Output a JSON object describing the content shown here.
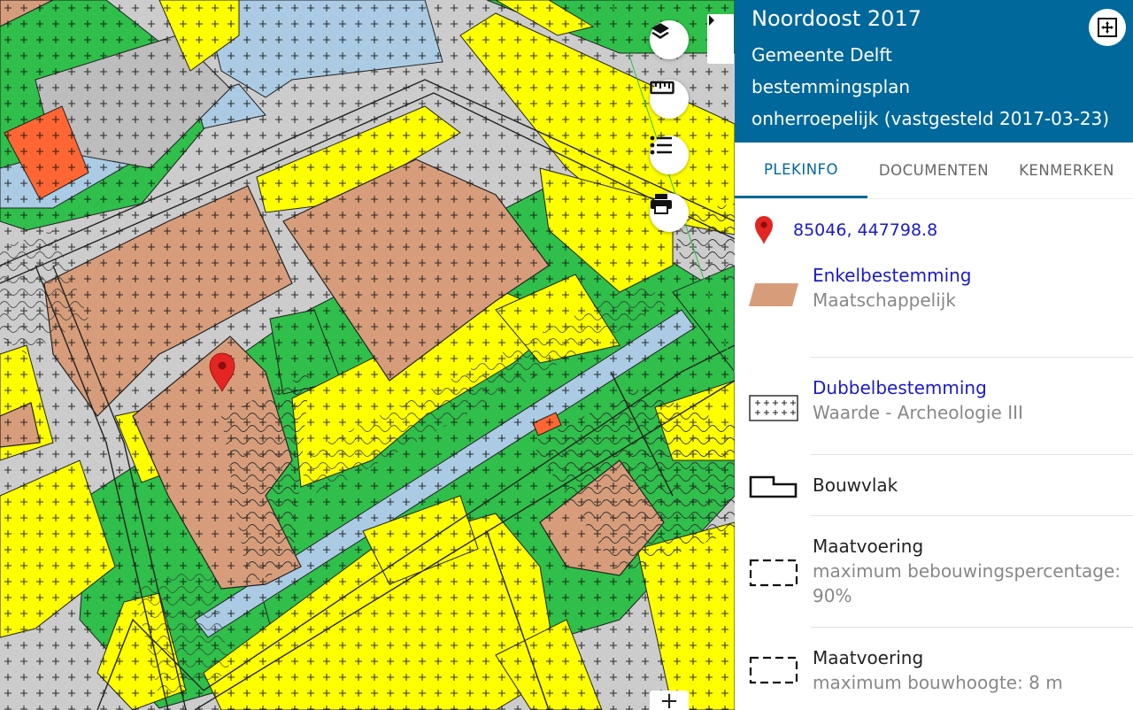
{
  "panel": {
    "title": "Noordoost 2017",
    "lines": [
      "Gemeente Delft",
      "bestemmingsplan",
      "onherroepelijk (vastgesteld 2017-03-23)"
    ],
    "tabs": [
      "PLEKINFO",
      "DOCUMENTEN",
      "KENMERKEN"
    ],
    "active_tab": "PLEKINFO",
    "coordinates": "85046, 447798.8",
    "items": [
      {
        "title": "Enkelbestemming",
        "sub": "Maatschappelijk",
        "symbol": "parallelogram-brown"
      },
      {
        "title": "Dubbelbestemming",
        "sub": "Waarde - Archeologie III",
        "symbol": "crosses-pattern"
      },
      {
        "title": "Bouwvlak",
        "sub": "",
        "symbol": "building-outline"
      },
      {
        "title": "Maatvoering",
        "sub": "maximum bebouwingspercentage: 90%",
        "symbol": "dashed-box"
      },
      {
        "title": "Maatvoering",
        "sub": "maximum bouwhoogte: 8 m",
        "symbol": "dashed-box"
      }
    ]
  },
  "map_tools": [
    "layers-icon",
    "ruler-icon",
    "legend-list-icon",
    "print-icon"
  ],
  "zoom_in_label": "+",
  "colors": {
    "header": "#01689b",
    "maatschappelijk": "#d79d7b",
    "wonen": "#ffff00",
    "groen": "#2fbf4a",
    "water": "#aacbe3",
    "verkeer": "#cccccc",
    "bedrijf": "#ff6633",
    "link": "#1a1acd"
  }
}
